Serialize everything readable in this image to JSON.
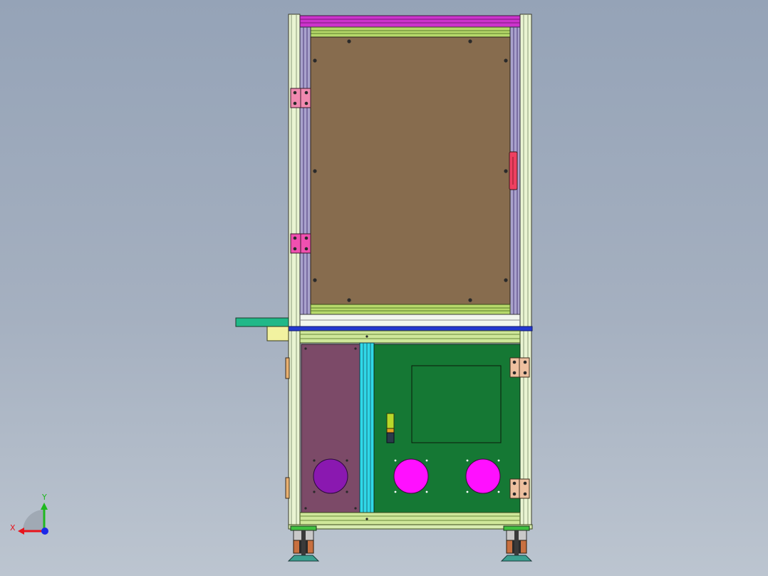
{
  "view": {
    "background_top": "#95a3b7",
    "background_bottom": "#bcc5d0"
  },
  "triad": {
    "x_label": "X",
    "y_label": "Y",
    "x_color": "#e8141c",
    "y_color": "#1fb81f",
    "z_color": "#1c28e8"
  },
  "model": {
    "panel_upper_color": "#876c4e",
    "panel_lower_left_color": "#7c4a68",
    "panel_lower_right_color": "#157834",
    "fan_left_color": "#8a18b0",
    "fan_right_color": "#ff10ff",
    "top_rail_color": "#cc33cc",
    "divider_rail_color": "#2338d0",
    "shelf_color": "#20b888",
    "door_handle_color": "#ee4060",
    "cable_duct_color": "#30d8e8"
  }
}
